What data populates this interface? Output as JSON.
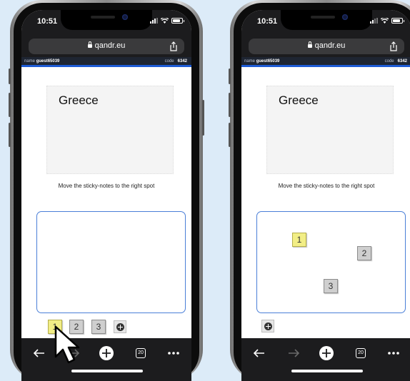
{
  "phones": [
    {
      "status": {
        "time": "10:51"
      },
      "browser": {
        "url": "qandr.eu",
        "tabs_count": "20"
      },
      "session": {
        "name_label": "name",
        "name_value": "guest65039",
        "code_label": "code",
        "code_value": "6342"
      },
      "card": {
        "title": "Greece"
      },
      "instruction": "Move the sticky-notes to the right spot",
      "notes": [
        "1",
        "2",
        "3"
      ]
    },
    {
      "status": {
        "time": "10:51"
      },
      "browser": {
        "url": "qandr.eu",
        "tabs_count": "20"
      },
      "session": {
        "name_label": "name",
        "name_value": "guest65039",
        "code_label": "code",
        "code_value": "6342"
      },
      "card": {
        "title": "Greece"
      },
      "instruction": "Move the sticky-notes to the right spot",
      "notes": [
        "1",
        "2",
        "3"
      ]
    }
  ],
  "colors": {
    "accent_blue": "#4a7fd8",
    "sticky_yellow": "#f2ee86",
    "sticky_grey": "#cfcfcf",
    "background": "#dcebf8"
  },
  "icons": [
    "lock-icon",
    "share-icon",
    "back-icon",
    "forward-icon",
    "new-tab-icon",
    "tabs-icon",
    "more-icon",
    "add-note-icon",
    "pointer-cursor-icon"
  ]
}
